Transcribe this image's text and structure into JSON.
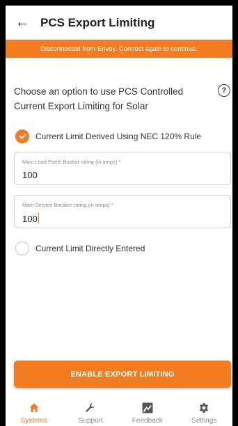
{
  "appbar": {
    "back_glyph": "←",
    "title": "PCS Export Limiting"
  },
  "banner": {
    "text": "Disconnected from Envoy. Connect again to continue."
  },
  "content": {
    "prompt": "Choose an option to use PCS Controlled Current Export Limiting for Solar",
    "help_glyph": "?",
    "option_nec": {
      "label": "Current Limit Derived Using NEC 120% Rule",
      "selected": true
    },
    "field_busbar": {
      "label": "Main Load Panel Busbar rating (in amps) *",
      "value": "100"
    },
    "field_breaker": {
      "label": "Main Service Breaker rating (in amps) *",
      "value": "100"
    },
    "option_direct": {
      "label": "Current Limit Directly Entered",
      "selected": false
    }
  },
  "actions": {
    "enable_label": "ENABLE EXPORT LIMITING"
  },
  "bottom_nav": {
    "systems": {
      "label": "Systems",
      "icon": "home-icon",
      "active": true
    },
    "support": {
      "label": "Support",
      "icon": "wrench-icon",
      "active": false
    },
    "feedback": {
      "label": "Feedback",
      "icon": "feedback-icon",
      "active": false
    },
    "settings": {
      "label": "Settings",
      "icon": "gear-icon",
      "active": false
    }
  },
  "colors": {
    "accent": "#f47b20",
    "text": "#333333",
    "inactive": "#8a8a8a"
  }
}
